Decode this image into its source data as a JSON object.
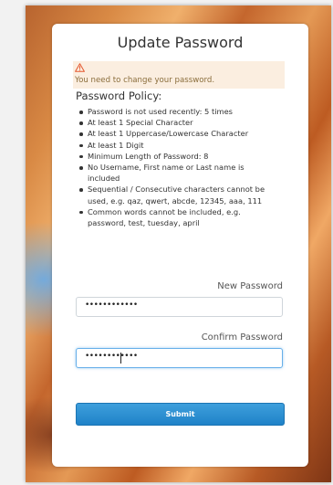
{
  "dialog": {
    "title": "Update Password"
  },
  "alert": {
    "message": "You need to change your password."
  },
  "policy": {
    "heading": "Password Policy:",
    "rules": [
      "Password is not used recently: 5 times",
      "At least 1 Special Character",
      "At least 1 Uppercase/Lowercase Character",
      "At least 1 Digit",
      "Minimum Length of Password: 8",
      "No Username, First name or Last name is included",
      "Sequential / Consecutive characters cannot be used, e.g. qaz, qwert, abcde, 12345, aaa, 111",
      "Common words cannot be included, e.g. password, test, tuesday, april"
    ]
  },
  "form": {
    "new_password_label": "New Password",
    "new_password_value": "••••••••••••",
    "confirm_password_label": "Confirm Password",
    "confirm_password_value": "••••••••••••",
    "submit_label": "Submit"
  },
  "colors": {
    "accent": "#2a8fd4",
    "alert_bg": "#fbeee0",
    "warning": "#e4572e"
  },
  "icons": {
    "alert": "warning-icon"
  }
}
